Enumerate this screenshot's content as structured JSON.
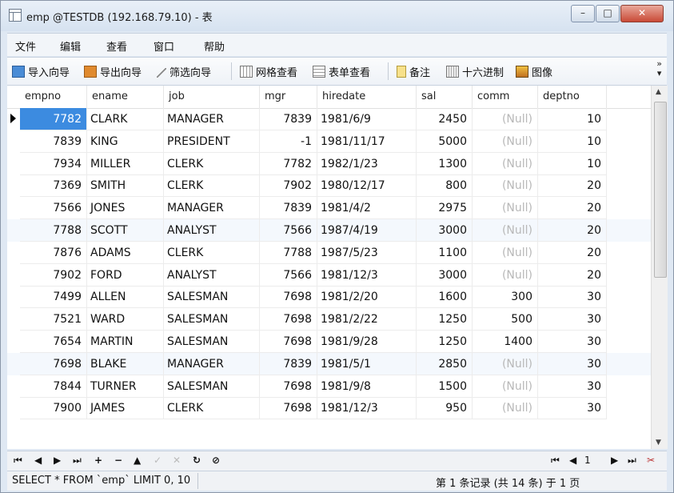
{
  "window": {
    "title": "emp @TESTDB (192.168.79.10) - 表"
  },
  "menu": [
    "文件",
    "编辑",
    "查看",
    "窗口",
    "帮助"
  ],
  "toolbar": {
    "items": [
      "导入向导",
      "导出向导",
      "筛选向导",
      "网格查看",
      "表单查看",
      "备注",
      "十六进制",
      "图像"
    ],
    "more": "»"
  },
  "grid": {
    "columns": [
      "empno",
      "ename",
      "job",
      "mgr",
      "hiredate",
      "sal",
      "comm",
      "deptno"
    ],
    "rows": [
      [
        "7782",
        "CLARK",
        "MANAGER",
        "7839",
        "1981/6/9",
        "2450",
        "(Null)",
        "10"
      ],
      [
        "7839",
        "KING",
        "PRESIDENT",
        "-1",
        "1981/11/17",
        "5000",
        "(Null)",
        "10"
      ],
      [
        "7934",
        "MILLER",
        "CLERK",
        "7782",
        "1982/1/23",
        "1300",
        "(Null)",
        "10"
      ],
      [
        "7369",
        "SMITH",
        "CLERK",
        "7902",
        "1980/12/17",
        "800",
        "(Null)",
        "20"
      ],
      [
        "7566",
        "JONES",
        "MANAGER",
        "7839",
        "1981/4/2",
        "2975",
        "(Null)",
        "20"
      ],
      [
        "7788",
        "SCOTT",
        "ANALYST",
        "7566",
        "1987/4/19",
        "3000",
        "(Null)",
        "20"
      ],
      [
        "7876",
        "ADAMS",
        "CLERK",
        "7788",
        "1987/5/23",
        "1100",
        "(Null)",
        "20"
      ],
      [
        "7902",
        "FORD",
        "ANALYST",
        "7566",
        "1981/12/3",
        "3000",
        "(Null)",
        "20"
      ],
      [
        "7499",
        "ALLEN",
        "SALESMAN",
        "7698",
        "1981/2/20",
        "1600",
        "300",
        "30"
      ],
      [
        "7521",
        "WARD",
        "SALESMAN",
        "7698",
        "1981/2/22",
        "1250",
        "500",
        "30"
      ],
      [
        "7654",
        "MARTIN",
        "SALESMAN",
        "7698",
        "1981/9/28",
        "1250",
        "1400",
        "30"
      ],
      [
        "7698",
        "BLAKE",
        "MANAGER",
        "7839",
        "1981/5/1",
        "2850",
        "(Null)",
        "30"
      ],
      [
        "7844",
        "TURNER",
        "SALESMAN",
        "7698",
        "1981/9/8",
        "1500",
        "(Null)",
        "30"
      ],
      [
        "7900",
        "JAMES",
        "CLERK",
        "7698",
        "1981/12/3",
        "950",
        "(Null)",
        "30"
      ]
    ]
  },
  "nav": {
    "page": "1"
  },
  "status": {
    "sql": "SELECT * FROM `emp` LIMIT 0, 10",
    "record": "第 1 条记录 (共 14 条) 于 1 页"
  },
  "colors": {
    "selected_cell": "#3c8be0",
    "null_text": "#b8b8b8",
    "stripe": "#f4f8fd"
  }
}
